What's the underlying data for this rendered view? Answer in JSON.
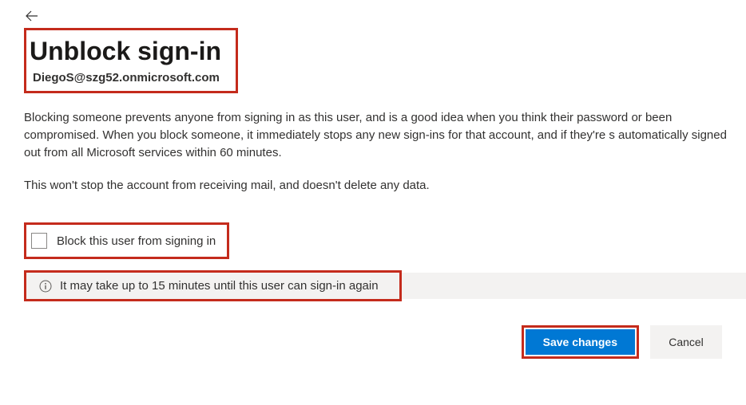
{
  "header": {
    "title": "Unblock sign-in",
    "user_email": "DiegoS@szg52.onmicrosoft.com"
  },
  "body": {
    "description": "Blocking someone prevents anyone from signing in as this user, and is a good idea when you think their password or been compromised. When you block someone, it immediately stops any new sign-ins for that account, and if they're s automatically signed out from all Microsoft services within 60 minutes.",
    "note": "This won't stop the account from receiving mail, and doesn't delete any data.",
    "checkbox_label": "Block this user from signing in",
    "checkbox_checked": false,
    "info_message": "It may take up to 15 minutes until this user can sign-in again"
  },
  "buttons": {
    "save": "Save changes",
    "cancel": "Cancel"
  },
  "highlight_color": "#c42b1c"
}
